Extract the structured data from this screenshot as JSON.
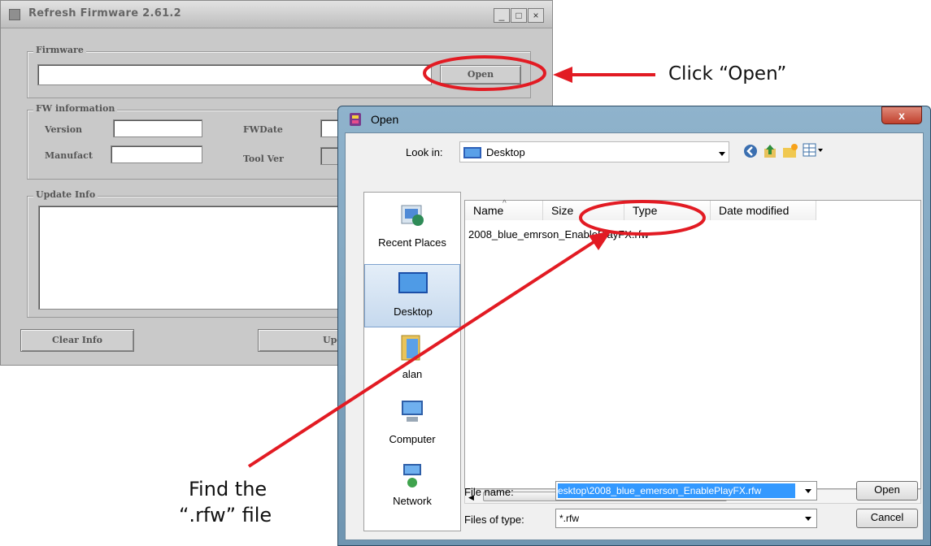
{
  "firmware_window": {
    "title": "Refresh Firmware 2.61.2",
    "firmware_group": "Firmware",
    "open_button": "Open",
    "fw_info_group": "FW information",
    "version_label": "Version",
    "fwdate_label": "FWDate",
    "manufacturer_label": "Manufact",
    "toolver_label": "Tool Ver",
    "update_info_group": "Update Info",
    "clear_info_button": "Clear Info",
    "update_button": "Upd"
  },
  "open_dialog": {
    "title": "Open",
    "close_glyph": "x",
    "look_in_label": "Look in:",
    "look_in_value": "Desktop",
    "places": [
      {
        "label": "Recent Places",
        "icon": "recent-places-icon"
      },
      {
        "label": "Desktop",
        "icon": "desktop-icon"
      },
      {
        "label": "alan",
        "icon": "user-folder-icon"
      },
      {
        "label": "Computer",
        "icon": "computer-icon"
      },
      {
        "label": "Network",
        "icon": "network-icon"
      }
    ],
    "columns": [
      "Name",
      "Size",
      "Type",
      "Date modified"
    ],
    "files": [
      "2008_blue_emrson_EnablePlayFX.rfw"
    ],
    "scroll_thumb_glyph": "III",
    "file_name_label": "File name:",
    "file_name_value": "esktop\\2008_blue_emerson_EnablePlayFX.rfw",
    "files_of_type_label": "Files of type:",
    "files_of_type_value": "*.rfw",
    "open_button": "Open",
    "cancel_button": "Cancel"
  },
  "annotations": {
    "click_open": "Click “Open”",
    "find_line1": "Find the",
    "find_line2": "“.rfw” file"
  },
  "colors": {
    "annotation_red": "#e21b23",
    "dialog_frame": "#7fa3bf",
    "selection_blue": "#3399ff"
  }
}
